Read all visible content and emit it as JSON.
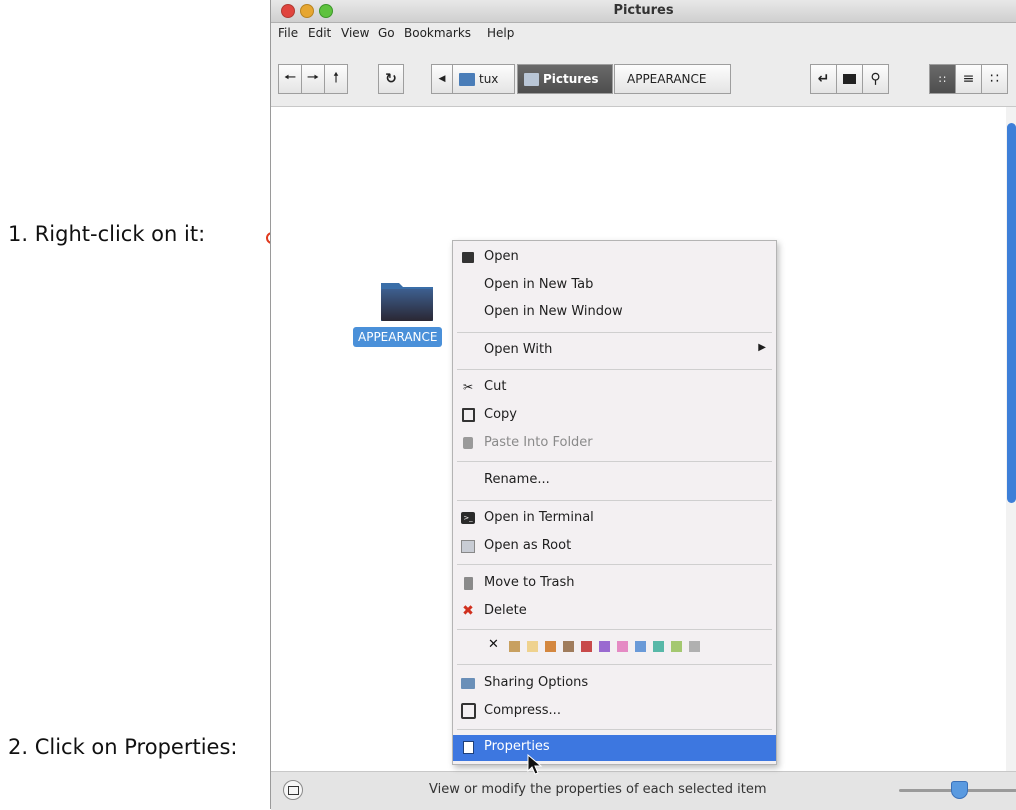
{
  "window": {
    "title": "Pictures"
  },
  "menubar": [
    "File",
    "Edit",
    "View",
    "Go",
    "Bookmarks",
    "Help"
  ],
  "toolbar": {
    "breadcrumbs": [
      "tux",
      "Pictures",
      "APPEARANCE"
    ]
  },
  "content": {
    "folder_label": "APPEARANCE"
  },
  "context_menu": {
    "items": {
      "open": "Open",
      "open_new_tab": "Open in New Tab",
      "open_new_window": "Open in New Window",
      "open_with": "Open With",
      "cut": "Cut",
      "copy": "Copy",
      "paste_into_folder": "Paste Into Folder",
      "rename": "Rename...",
      "open_in_terminal": "Open in Terminal",
      "open_as_root": "Open as Root",
      "move_to_trash": "Move to Trash",
      "delete": "Delete",
      "sharing_options": "Sharing Options",
      "compress": "Compress...",
      "properties": "Properties"
    },
    "color_tags": [
      "#c8a060",
      "#efd28e",
      "#d4873f",
      "#a07c5c",
      "#c84a4a",
      "#9a6ad0",
      "#e58ac4",
      "#6a9ad8",
      "#58b8a8",
      "#a4c870",
      "#b0b0b0"
    ]
  },
  "statusbar": {
    "text": "View or modify the properties of each selected item"
  },
  "annotations": {
    "step1": "1. Right-click on it:",
    "step2": "2. Click on Properties:"
  },
  "colors": {
    "accent": "#3d77e0",
    "annotation_arrow": "#e03a1e",
    "selection": "#4a90d9"
  }
}
